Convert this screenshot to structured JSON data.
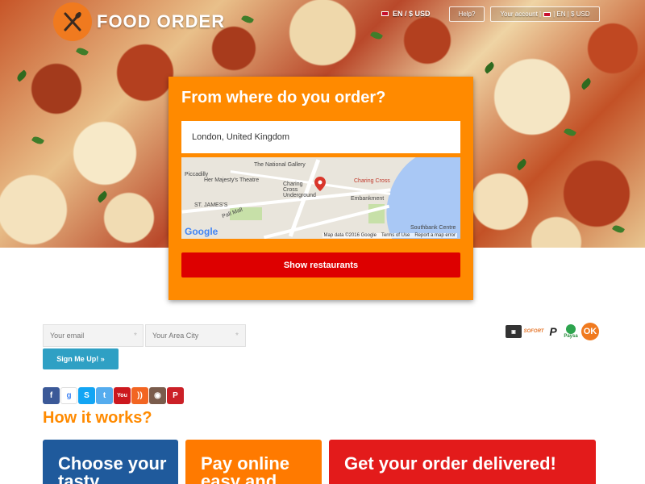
{
  "header": {
    "logo_text": "FOOD ORDER",
    "language_currency": "EN / $ USD",
    "help_label": "Help?",
    "account_label": "Your account |",
    "account_lang": "| EN | $ USD"
  },
  "order": {
    "title": "From where do you order?",
    "location_value": "London, United Kingdom",
    "show_button": "Show restaurants",
    "map": {
      "labels": {
        "national_gallery": "The National Gallery",
        "piccadilly": "Piccadilly",
        "majestys": "Her Majesty's Theatre",
        "charing_cross_under": "Charing Cross Underground",
        "charing_cross": "Charing Cross",
        "embankment": "Embankment",
        "st_james": "ST. JAMES'S",
        "pall_mall": "Pall Mall",
        "southbank": "Southbank Centre"
      },
      "google": "Google",
      "map_data": "Map data ©2016 Google",
      "terms": "Terms of Use",
      "report": "Report a map error"
    }
  },
  "newsletter": {
    "email_placeholder": "Your email",
    "city_placeholder": "Your Area City",
    "signup_button": "Sign Me Up! »"
  },
  "payments": {
    "sofort": "SOFORT",
    "paysa": "Paysa",
    "ok": "OK"
  },
  "how": {
    "title": "How it works?",
    "cards": [
      {
        "text": "Choose your tasty"
      },
      {
        "text": "Pay online easy and"
      },
      {
        "text": "Get your order delivered!"
      }
    ]
  },
  "colors": {
    "orange": "#ff8a00",
    "red": "#dd0000",
    "blue": "#1f5a9c",
    "teal": "#2fa0c4"
  }
}
